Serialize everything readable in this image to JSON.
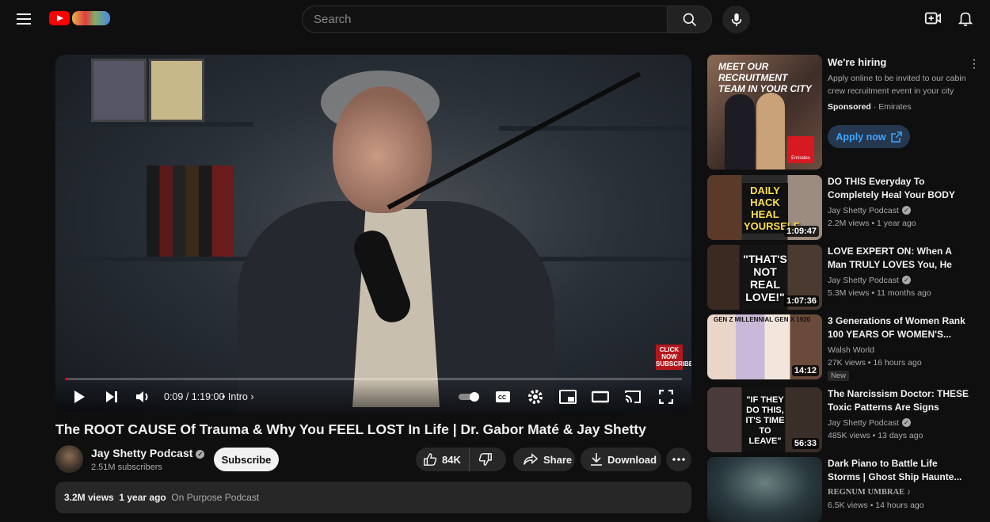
{
  "colors": {
    "accent": "#ff0000",
    "bg": "#0f0f0f",
    "chip": "#272727",
    "link": "#3ea6ff"
  },
  "header": {
    "search_placeholder": "Search",
    "icons": [
      "menu-icon",
      "youtube-logo",
      "search-icon",
      "mic-icon",
      "create-icon",
      "bell-icon"
    ]
  },
  "player": {
    "time": "0:09 / 1:19:00",
    "chapter": "Intro",
    "progress": 0.002,
    "overlay_badge": "CLICK NOW SUBSCRIBE"
  },
  "video": {
    "title": "The ROOT CAUSE Of Trauma & Why You FEEL LOST In Life | Dr. Gabor Maté & Jay Shetty",
    "channel": "Jay Shetty Podcast",
    "subscribers": "2.51M subscribers",
    "subscribe_label": "Subscribe",
    "likes": "84K",
    "share_label": "Share",
    "download_label": "Download",
    "views": "3.2M views",
    "age": "1 year ago",
    "tag": "On Purpose Podcast"
  },
  "ad": {
    "thumb_text": "MEET OUR RECRUITMENT TEAM IN YOUR CITY",
    "brand_mark": "Emirates",
    "title": "We're hiring",
    "description": "Apply online to be invited to our cabin crew recruitment event in your city",
    "sponsored_label": "Sponsored",
    "advertiser": "Emirates",
    "cta": "Apply now"
  },
  "recommendations": [
    {
      "title": "DO THIS Everyday To Completely Heal Your BODY &...",
      "channel": "Jay Shetty Podcast",
      "verified": true,
      "views": "2.2M views",
      "age": "1 year ago",
      "duration": "1:09:47",
      "thumb_caption": "DAILY HACK HEAL YOURSELF",
      "badge": ""
    },
    {
      "title": "LOVE EXPERT ON: When A Man TRULY LOVES You, He Will DO...",
      "channel": "Jay Shetty Podcast",
      "verified": true,
      "views": "5.3M views",
      "age": "11 months ago",
      "duration": "1:07:36",
      "thumb_caption": "\"THAT'S NOT REAL LOVE!\"",
      "badge": ""
    },
    {
      "title": "3 Generations of Women Rank 100 YEARS OF WOMEN'S...",
      "channel": "Walsh World",
      "verified": false,
      "views": "27K views",
      "age": "16 hours ago",
      "duration": "14:12",
      "thumb_caption": "GEN Z MILLENNIAL GEN X 1920",
      "badge": "New"
    },
    {
      "title": "The Narcissism Doctor: THESE Toxic Patterns Are Signs You'r...",
      "channel": "Jay Shetty Podcast",
      "verified": true,
      "views": "485K views",
      "age": "13 days ago",
      "duration": "56:33",
      "thumb_caption": "\"IF THEY DO THIS, IT'S TIME TO LEAVE\"",
      "badge": ""
    },
    {
      "title": "Dark Piano to Battle Life Storms | Ghost Ship Haunte...",
      "channel": "REGNUM UMBRAE ♪",
      "verified": false,
      "views": "6.5K views",
      "age": "14 hours ago",
      "duration": "",
      "thumb_caption": "",
      "badge": ""
    }
  ]
}
